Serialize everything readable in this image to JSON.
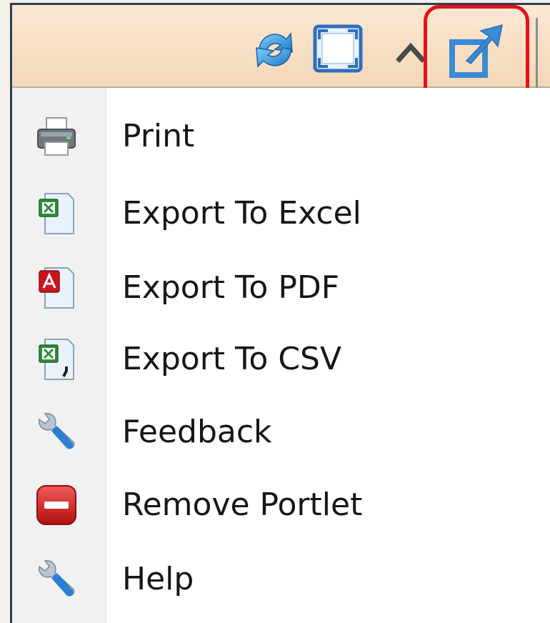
{
  "toolbar": {
    "icons": [
      "refresh-icon",
      "maximize-icon",
      "collapse-icon",
      "pop-out-icon"
    ],
    "highlight_color": "#e5101a"
  },
  "menu": {
    "items": [
      {
        "label": "Print",
        "icon": "printer-icon"
      },
      {
        "label": "Export To Excel",
        "icon": "excel-file-icon"
      },
      {
        "label": "Export To PDF",
        "icon": "pdf-file-icon"
      },
      {
        "label": "Export To CSV",
        "icon": "csv-file-icon"
      },
      {
        "label": "Feedback",
        "icon": "wrench-icon"
      },
      {
        "label": "Remove Portlet",
        "icon": "remove-icon"
      },
      {
        "label": "Help",
        "icon": "wrench-icon"
      }
    ]
  },
  "colors": {
    "toolbar_bg": "#f7dfc3",
    "frame_border": "#2e3f57",
    "gutter_bg": "#f1f1f1",
    "text": "#161616",
    "icon_blue": "#3a8ad6"
  }
}
